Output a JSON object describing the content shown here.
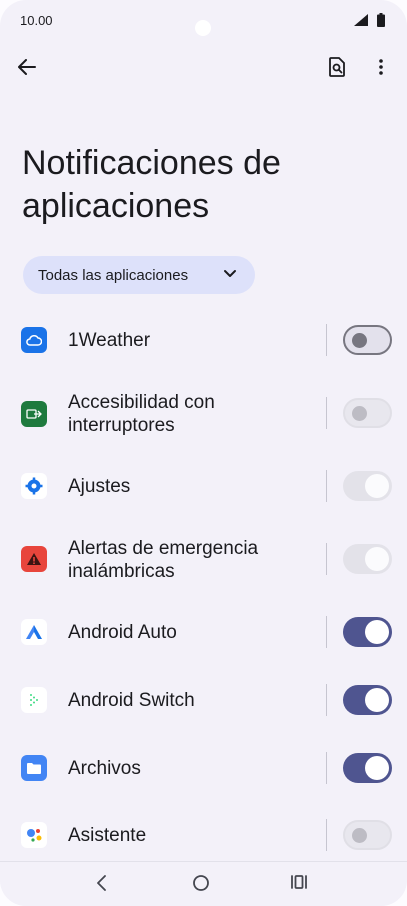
{
  "status": {
    "time": "10.00"
  },
  "header": {
    "title": "Notificaciones de aplicaciones"
  },
  "filter": {
    "label": "Todas las aplicaciones"
  },
  "apps": [
    {
      "label": "1Weather",
      "state": "off",
      "icon": "cloud-icon",
      "color": "#1a73e8"
    },
    {
      "label": "Accesibilidad con interruptores",
      "state": "off-disabled",
      "icon": "switch-access-icon",
      "color": "#1e7a3e"
    },
    {
      "label": "Ajustes",
      "state": "on-disabled",
      "icon": "gear-icon",
      "color": "#1a73e8"
    },
    {
      "label": "Alertas de emergencia inalámbricas",
      "state": "on-disabled",
      "icon": "warning-icon",
      "color": "#e8453c"
    },
    {
      "label": "Android Auto",
      "state": "on",
      "icon": "android-auto-icon",
      "color": "#4285f4"
    },
    {
      "label": "Android Switch",
      "state": "on",
      "icon": "android-switch-icon",
      "color": "#3ddc84"
    },
    {
      "label": "Archivos",
      "state": "on",
      "icon": "folder-icon",
      "color": "#4285f4"
    },
    {
      "label": "Asistente",
      "state": "off-disabled",
      "icon": "assistant-icon",
      "color": "#4285f4"
    }
  ],
  "colors": {
    "accent": "#4f5590",
    "chip": "#dde1fa",
    "background": "#f3f1f9"
  }
}
